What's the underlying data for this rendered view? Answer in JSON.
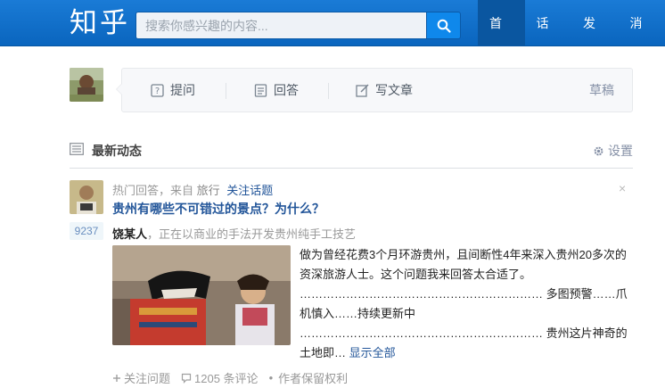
{
  "header": {
    "logo": "知乎",
    "search_placeholder": "搜索你感兴趣的内容...",
    "nav": [
      "首页",
      "话题",
      "发现",
      "消息"
    ]
  },
  "composer": {
    "ask": "提问",
    "answer": "回答",
    "write": "写文章",
    "draft": "草稿"
  },
  "feed": {
    "title": "最新动态",
    "settings": "设置"
  },
  "item": {
    "meta_prefix": "热门回答，来自",
    "topic": "旅行",
    "follow": "关注话题",
    "close": "×",
    "question": "贵州有哪些不可错过的景点？为什么？",
    "votes": "9237",
    "author_name": "饶某人",
    "author_sep": "，",
    "author_bio": "正在以商业的手法开发贵州纯手工技艺",
    "summary_1": "做为曾经花费3个月环游贵州，且间断性4年来深入贵州20多次的资深旅游人士。这个问题我来回答太合适了。",
    "summary_dots_1": "………………………………………………………",
    "summary_2": "多图预警……爪机慎入……持续更新中",
    "summary_dots_2": "………………………………………………………",
    "summary_3": "贵州这片神奇的土地即…",
    "show_all": "显示全部",
    "follow_question": "关注问题",
    "comments": "1205 条评论",
    "copyright": "作者保留权利"
  }
}
